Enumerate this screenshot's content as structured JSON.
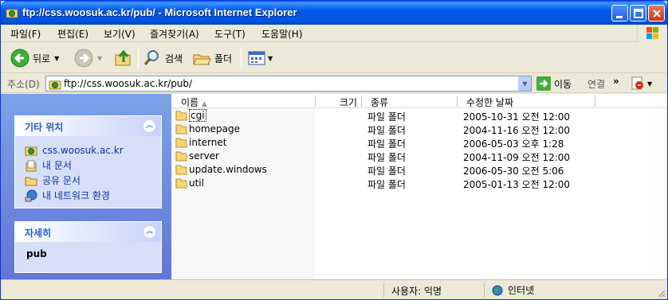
{
  "window": {
    "title": "ftp://css.woosuk.ac.kr/pub/ - Microsoft Internet Explorer"
  },
  "menu": [
    "파일(F)",
    "편집(E)",
    "보기(V)",
    "즐겨찾기(A)",
    "도구(T)",
    "도움말(H)"
  ],
  "toolbar": {
    "back": "뒤로",
    "search": "검색",
    "folders": "폴더"
  },
  "address": {
    "label": "주소(D)",
    "value": "ftp://css.woosuk.ac.kr/pub/",
    "go": "이동",
    "links": "연결"
  },
  "other_places": {
    "title": "기타 위치",
    "items": [
      "css.woosuk.ac.kr",
      "내 문서",
      "공유 문서",
      "내 네트워크 환경"
    ]
  },
  "details": {
    "title": "자세히",
    "name": "pub"
  },
  "columns": {
    "name": "이름",
    "size": "크기",
    "type": "종류",
    "modified": "수정한 날짜"
  },
  "files": [
    {
      "name": "cgi",
      "type": "파일 폴더",
      "modified": "2005-10-31 오전 12:00"
    },
    {
      "name": "homepage",
      "type": "파일 폴더",
      "modified": "2004-11-16 오전 12:00"
    },
    {
      "name": "internet",
      "type": "파일 폴더",
      "modified": "2006-05-03 오후 1:28"
    },
    {
      "name": "server",
      "type": "파일 폴더",
      "modified": "2004-11-09 오전 12:00"
    },
    {
      "name": "update.windows",
      "type": "파일 폴더",
      "modified": "2006-05-30 오전 5:06"
    },
    {
      "name": "util",
      "type": "파일 폴더",
      "modified": "2005-01-13 오전 12:00"
    }
  ],
  "status": {
    "user": "사용자: 익명",
    "zone": "인터넷"
  },
  "colors": {
    "titlebar": "#0054e3",
    "taskpane": "#6375d6",
    "link": "#0c32a5",
    "folder": "#f7d575"
  }
}
